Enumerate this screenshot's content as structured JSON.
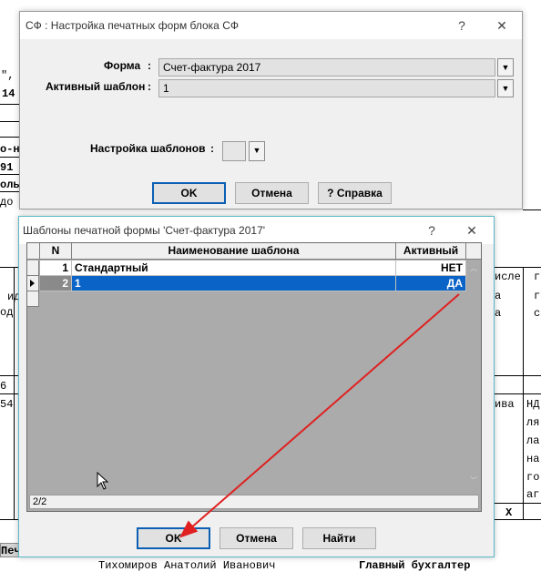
{
  "background": {
    "left_fragments": [
      "\",",
      "14",
      "о-н",
      "91",
      "оль",
      "до",
      "ид",
      "од",
      "6",
      "54"
    ],
    "right_fragments": [
      "исле",
      "a",
      "a",
      "ива",
      "НД",
      "ля",
      "ла",
      "на",
      "го",
      "аг"
    ],
    "far_right_fragments": [
      "г",
      "го",
      "с"
    ],
    "x_mark": "X",
    "bottom_names": [
      "Тихомиров Анатолий Иванович",
      "Главный бухгалтер"
    ],
    "tab_label": "Печ"
  },
  "dialog1": {
    "title": "СФ : Настройка печатных форм блока СФ",
    "help_icon": "?",
    "close_icon": "✕",
    "form_label": "Форма",
    "form_value": "Счет-фактура 2017",
    "template_label": "Активный шаблон",
    "template_value": "1",
    "templates_setup_label": "Настройка шаблонов",
    "colon": ":",
    "ok": "OK",
    "cancel": "Отмена",
    "help": "? Справка"
  },
  "dialog2": {
    "title": "Шаблоны печатной формы 'Счет-фактура 2017'",
    "help_icon": "?",
    "close_icon": "✕",
    "columns": [
      "N",
      "Наименование шаблона",
      "Активный"
    ],
    "rows": [
      {
        "n": "1",
        "name": "Стандартный",
        "active": "НЕТ",
        "selected": false
      },
      {
        "n": "2",
        "name": "1",
        "active": "ДА",
        "selected": true
      }
    ],
    "status": "2/2",
    "ok": "OK",
    "cancel": "Отмена",
    "find": "Найти"
  },
  "colors": {
    "selection": "#0a64c8",
    "arrow": "#e02020",
    "focus_border": "#0c5fb3"
  }
}
